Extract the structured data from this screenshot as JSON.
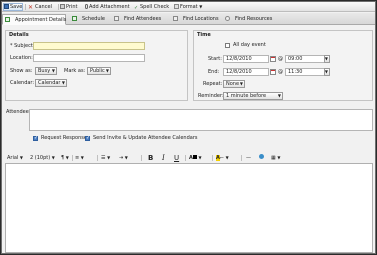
{
  "toolbar": {
    "save": "Save",
    "cancel": "Cancel",
    "print": "Print",
    "add_attachment": "Add Attachment",
    "spell_check": "Spell Check",
    "format": "Format"
  },
  "tabs": [
    {
      "label": "Appointment Details"
    },
    {
      "label": "Schedule"
    },
    {
      "label": "Find Attendees"
    },
    {
      "label": "Find Locations"
    },
    {
      "label": "Find Resources"
    }
  ],
  "details": {
    "title": "Details",
    "subject_label": "* Subject:",
    "subject_value": "",
    "location_label": "Location:",
    "location_value": "",
    "show_as_label": "Show as:",
    "show_as_value": "Busy",
    "mark_as_label": "Mark as:",
    "mark_as_value": "Public",
    "calendar_label": "Calendar:",
    "calendar_value": "Calendar"
  },
  "time": {
    "title": "Time",
    "all_day_label": "All day event",
    "all_day_checked": false,
    "start_label": "Start:",
    "start_date": "12/8/2010",
    "start_at": "@",
    "start_time": "09:00",
    "end_label": "End:",
    "end_date": "12/8/2010",
    "end_at": "@",
    "end_time": "11:30",
    "repeat_label": "Repeat:",
    "repeat_value": "None",
    "reminder_label": "Reminder:",
    "reminder_value": "1 minute before"
  },
  "attendees": {
    "label": "Attendees:",
    "value": "",
    "request_responses": "Request Responses",
    "send_invite": "Send Invite & Update Attendee Calendars"
  },
  "format_bar": {
    "font": "Arial",
    "size": "2 (10pt)",
    "bold": "B",
    "italic": "I",
    "underline": "U"
  }
}
